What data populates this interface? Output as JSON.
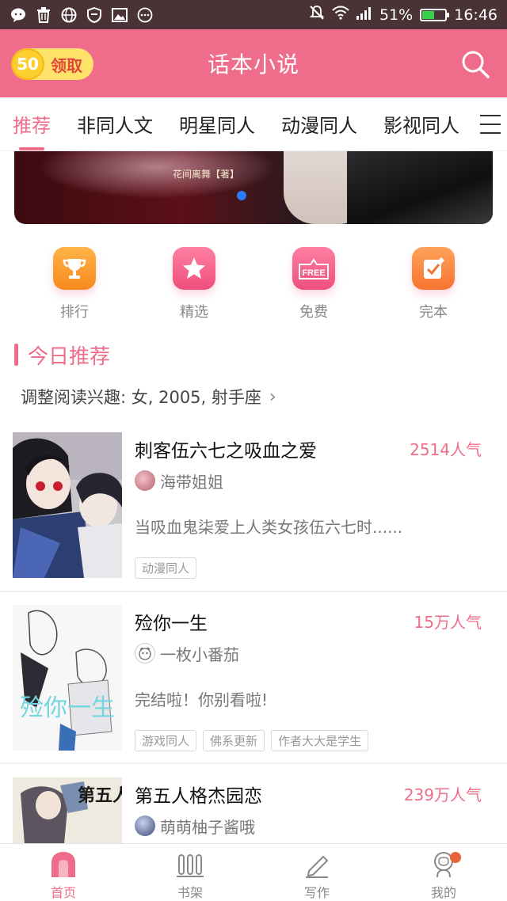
{
  "status_bar": {
    "battery": "51%",
    "battery_level": 0.51,
    "time": "16:46",
    "left_icons": [
      "wechat-icon",
      "trash-icon",
      "globe-icon",
      "shield-icon",
      "image-icon",
      "more-icon"
    ],
    "right_icons": [
      "mute-icon",
      "wifi-icon",
      "signal-icon",
      "battery-icon"
    ]
  },
  "header": {
    "coin_value": "50",
    "claim_label": "领取",
    "title": "话本小说",
    "accent_color": "#ef6d8b"
  },
  "tabs": [
    {
      "label": "推荐",
      "active": true
    },
    {
      "label": "非同人文",
      "active": false
    },
    {
      "label": "明星同人",
      "active": false
    },
    {
      "label": "动漫同人",
      "active": false
    },
    {
      "label": "影视同人",
      "active": false
    }
  ],
  "banner": {
    "subtitle": "花间离舞【著】"
  },
  "quick_actions": [
    {
      "label": "排行",
      "icon": "trophy-icon",
      "color": "#f7a232"
    },
    {
      "label": "精选",
      "icon": "star-icon",
      "color": "#ef5a86"
    },
    {
      "label": "免费",
      "icon": "free-tag-icon",
      "color": "#ef5a86"
    },
    {
      "label": "完本",
      "icon": "check-note-icon",
      "color": "#f7853a"
    }
  ],
  "section": {
    "title": "今日推荐",
    "interest": "调整阅读兴趣: 女, 2005, 射手座"
  },
  "books": [
    {
      "title": "刺客伍六七之吸血之爱",
      "popularity": "2514人气",
      "author": "海带姐姐",
      "desc": "当吸血鬼柒爱上人类女孩伍六七时......",
      "tags": [
        "动漫同人"
      ]
    },
    {
      "title": "殓你一生",
      "popularity": "15万人气",
      "author": "一枚小番茄",
      "desc": "完结啦！你别看啦!",
      "cover_text": "殓你一生",
      "tags": [
        "游戏同人",
        "佛系更新",
        "作者大大是学生"
      ]
    },
    {
      "title": "第五人格杰园恋",
      "popularity": "239万人气",
      "author": "萌萌柚子酱哦",
      "desc": "",
      "cover_text": "第五人",
      "tags": []
    }
  ],
  "bottom_nav": [
    {
      "label": "首页",
      "icon": "home-icon",
      "active": true
    },
    {
      "label": "书架",
      "icon": "bookshelf-icon",
      "active": false
    },
    {
      "label": "写作",
      "icon": "pen-icon",
      "active": false
    },
    {
      "label": "我的",
      "icon": "profile-icon",
      "active": false
    }
  ]
}
